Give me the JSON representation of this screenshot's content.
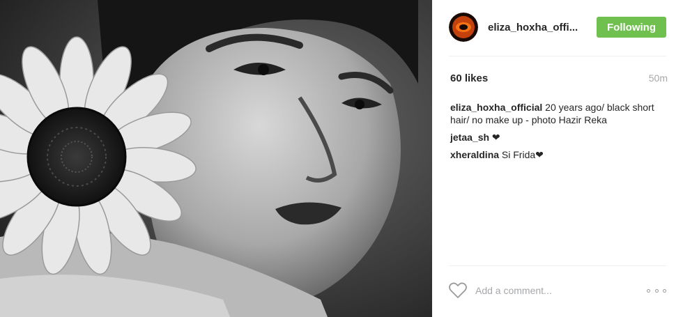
{
  "post": {
    "photo_alt": "Black and white portrait with sunflower",
    "username": "eliza_hoxha_official",
    "username_display": "eliza_hoxha_offi...",
    "follow_label": "Following",
    "likes": "60 likes",
    "time": "50m",
    "comments": [
      {
        "user": "eliza_hoxha_official",
        "text": " 20 years ago/ black short hair/ no make up - photo Hazir Reka"
      },
      {
        "user": "jetaa_sh",
        "text": " ❤"
      },
      {
        "user": "xheraldina",
        "text": " Si Frida❤"
      }
    ],
    "add_comment_placeholder": "Add a comment...",
    "icons": {
      "like": "heart-icon",
      "more": "more-options-icon"
    }
  },
  "colors": {
    "follow_bg": "#70c050",
    "muted": "#a5a7aa",
    "text": "#262626"
  }
}
